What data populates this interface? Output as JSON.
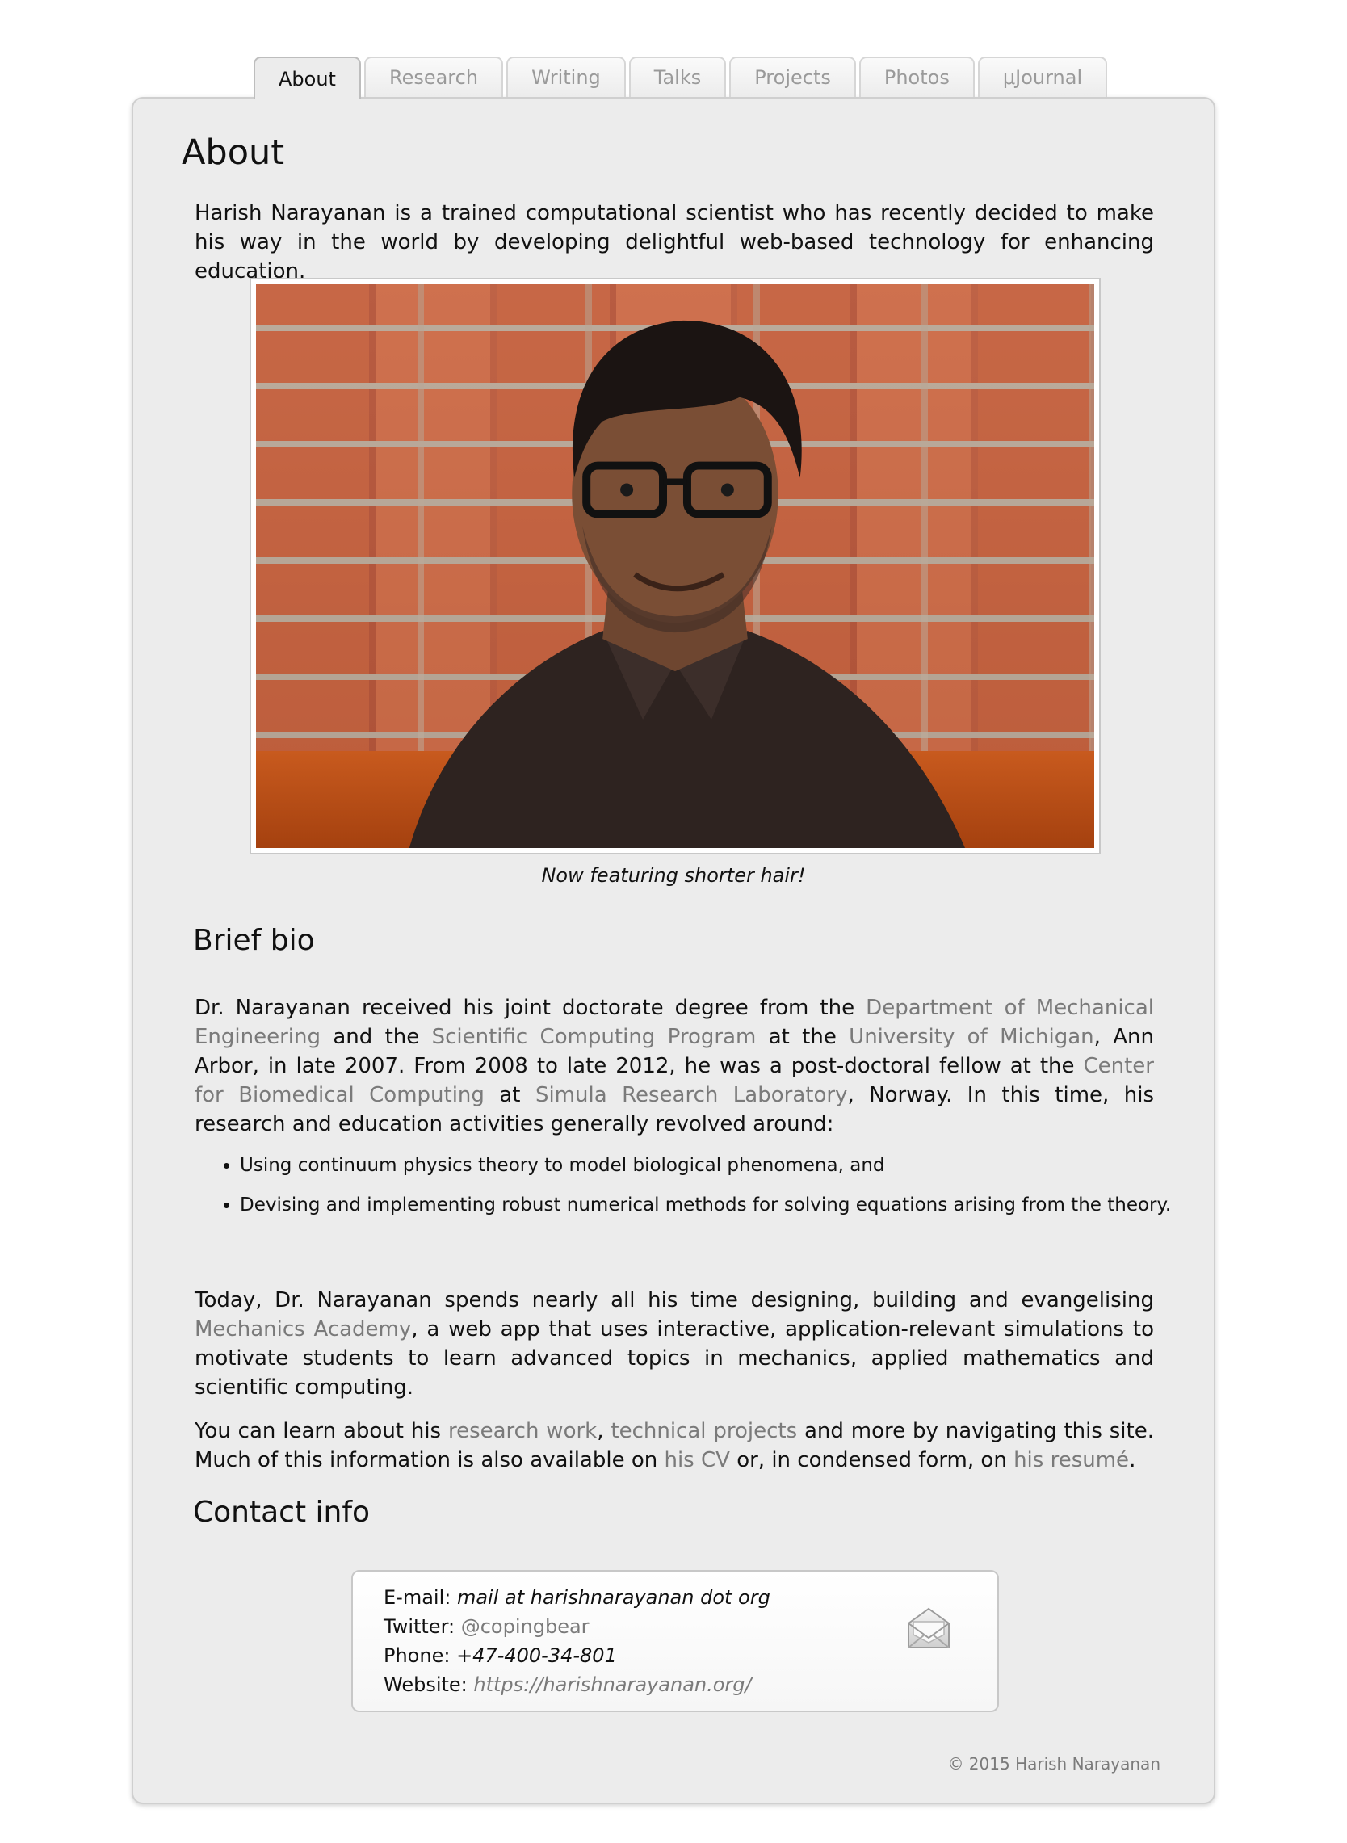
{
  "tabs": [
    {
      "label": "About",
      "active": true
    },
    {
      "label": "Research"
    },
    {
      "label": "Writing"
    },
    {
      "label": "Talks"
    },
    {
      "label": "Projects"
    },
    {
      "label": "Photos"
    },
    {
      "label": "μJournal"
    }
  ],
  "page_title": "About",
  "intro": "Harish Narayanan is a trained computational scientist who has recently decided to make his way in the world by developing delightful web-based technology for enhancing education.",
  "photo_caption": "Now featuring shorter hair!",
  "bio": {
    "heading": "Brief bio",
    "p1": {
      "t1": "Dr. Narayanan received his joint doctorate degree from the ",
      "link1": "Department of Mechanical Engineering",
      "t2": " and the ",
      "link2": "Scientific Computing Program",
      "t3": " at the ",
      "link3": "University of Michigan",
      "t4": ", Ann Arbor, in late 2007. From 2008 to late 2012, he was a post-doctoral fellow at the ",
      "link4": "Center for Biomedical Computing",
      "t5": " at ",
      "link5": "Simula Research Laboratory",
      "t6": ", Norway. In this time, his research and education activities generally revolved around:"
    },
    "list": [
      "Using continuum physics theory to model biological phenomena, and",
      "Devising and implementing robust numerical methods for solving equations arising from the theory."
    ],
    "p2": {
      "t1": "Today, Dr. Narayanan spends nearly all his time designing, building and evangelising ",
      "link1": "Mechanics Academy",
      "t2": ", a web app that uses interactive, application-relevant simulations to motivate students to learn advanced topics in mechanics, applied mathematics and scientific computing."
    },
    "p3": {
      "t1": "You can learn about his ",
      "link1": "research work",
      "t2": ", ",
      "link2": "technical projects",
      "t3": " and more by navigating this site. Much of this information is also available on ",
      "link3": "his CV",
      "t4": " or, in condensed form, on ",
      "link4": "his resumé",
      "t5": "."
    }
  },
  "contact": {
    "heading": "Contact info",
    "email_label": "E-mail: ",
    "email_value": "mail at harishnarayanan dot org",
    "twitter_label": "Twitter: ",
    "twitter_value": "@copingbear",
    "phone_label": "Phone: ",
    "phone_value": "+47-400-34-801",
    "website_label": "Website: ",
    "website_value": "https://harishnarayanan.org/",
    "icon": "envelope-icon"
  },
  "footer": "© 2015 Harish Narayanan"
}
